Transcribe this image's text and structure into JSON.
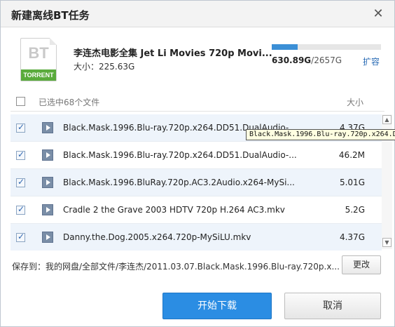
{
  "dialog": {
    "title": "新建离线BT任务",
    "close_glyph": "✕"
  },
  "torrent": {
    "icon_text": "BT",
    "icon_band": "TORRENT",
    "name": "李连杰电影全集 Jet Li Movies 720p Movi...",
    "size": "大小：225.63G"
  },
  "quota": {
    "used": "630.89G",
    "total": "/2657G",
    "fill_fraction": 0.237,
    "expand_label": "扩容"
  },
  "list": {
    "selected_count": "已选中68个文件",
    "size_header": "大小",
    "rows": [
      {
        "name": "Black.Mask.1996.Blu-ray.720p.x264.DD51.DualAudio-...",
        "size": "4.37G",
        "checked": true
      },
      {
        "name": "Black.Mask.1996.Blu-ray.720p.x264.DD51.DualAudio-...",
        "size": "46.2M",
        "checked": true
      },
      {
        "name": "Black.Mask.1996.BluRay.720p.AC3.2Audio.x264-MySi...",
        "size": "5.01G",
        "checked": true
      },
      {
        "name": "Cradle 2 the Grave 2003 HDTV 720p H.264 AC3.mkv",
        "size": "5.2G",
        "checked": true
      },
      {
        "name": "Danny.the.Dog.2005.x264.720p-MySiLU.mkv",
        "size": "4.37G",
        "checked": true
      }
    ],
    "tooltip": "Black.Mask.1996.Blu-ray.720p.x264.D"
  },
  "save": {
    "path": "保存到：我的网盘/全部文件/李连杰/2011.03.07.Black.Mask.1996.Blu-ray.720p.x...",
    "change_label": "更改"
  },
  "actions": {
    "start_label": "开始下载",
    "cancel_label": "取消"
  },
  "colors": {
    "accent": "#2b8de3",
    "torrent_green": "#5aab3c",
    "link": "#2a6bb5"
  }
}
